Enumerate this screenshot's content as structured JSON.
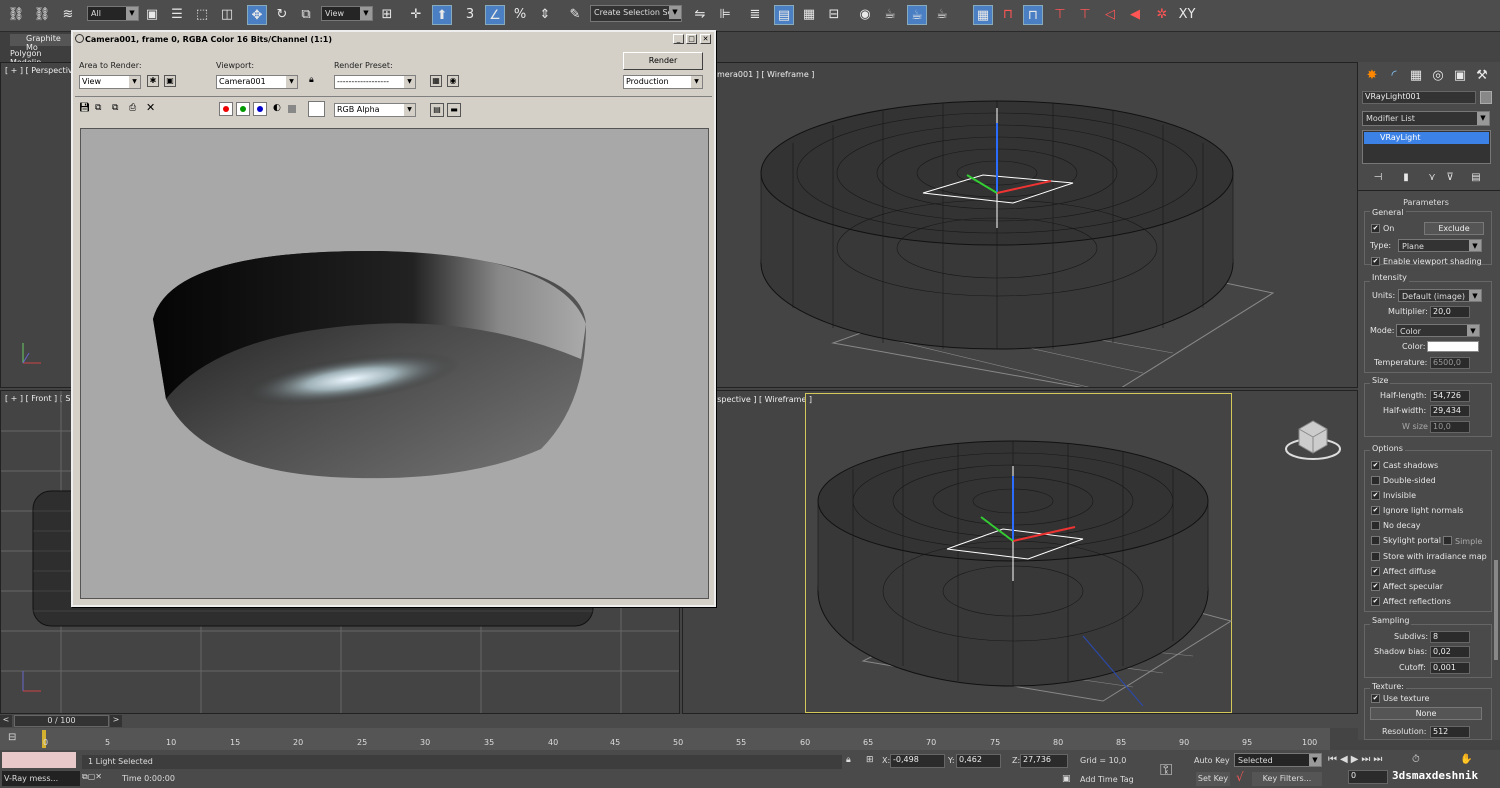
{
  "toolbar": {
    "filter": "All",
    "view": "View",
    "selection_set": "Create Selection Se"
  },
  "ribbon": {
    "tab1": "Graphite Mo",
    "tab2": "Polygon Modelin"
  },
  "viewports": {
    "top_left": "[ + ] [ Perspective",
    "top_right": "mera001 ] [ Wireframe ]",
    "bottom_left": "[ + ] [ Front ] [ Sha",
    "bottom_right": "erspective ] [ Wireframe ]"
  },
  "render_window": {
    "title": "Camera001, frame 0, RGBA Color 16 Bits/Channel (1:1)",
    "area_label": "Area to Render:",
    "area_value": "View",
    "viewport_label": "Viewport:",
    "viewport_value": "Camera001",
    "preset_label": "Render Preset:",
    "preset_value": "------------------",
    "render_button": "Render",
    "production": "Production",
    "channel": "RGB Alpha"
  },
  "command_panel": {
    "object_name": "VRayLight001",
    "modifier_list": "Modifier List",
    "stack_item": "VRayLight",
    "rollout_title": "Parameters",
    "general": "General",
    "on_label": "On",
    "exclude_btn": "Exclude",
    "type_label": "Type:",
    "type_value": "Plane",
    "enable_vp_shading": "Enable viewport shading",
    "intensity": "Intensity",
    "units_label": "Units:",
    "units_value": "Default (image)",
    "multiplier_label": "Multiplier:",
    "multiplier_value": "20,0",
    "mode_label": "Mode:",
    "mode_value": "Color",
    "color_label": "Color:",
    "temperature_label": "Temperature:",
    "temperature_value": "6500,0",
    "size": "Size",
    "half_length_label": "Half-length:",
    "half_length_value": "54,726",
    "half_width_label": "Half-width:",
    "half_width_value": "29,434",
    "w_size_label": "W size",
    "w_size_value": "10,0",
    "options": "Options",
    "opt_cast_shadows": "Cast shadows",
    "opt_double_sided": "Double-sided",
    "opt_invisible": "Invisible",
    "opt_ignore_normals": "Ignore light normals",
    "opt_no_decay": "No decay",
    "opt_skylight_portal": "Skylight portal",
    "opt_simple": "Simple",
    "opt_store_irradiance": "Store with irradiance map",
    "opt_affect_diffuse": "Affect diffuse",
    "opt_affect_specular": "Affect specular",
    "opt_affect_reflections": "Affect reflections",
    "sampling": "Sampling",
    "subdivs_label": "Subdivs:",
    "subdivs_value": "8",
    "shadow_bias_label": "Shadow bias:",
    "shadow_bias_value": "0,02",
    "cutoff_label": "Cutoff:",
    "cutoff_value": "0,001",
    "texture": "Texture:",
    "use_texture": "Use texture",
    "none_btn": "None",
    "resolution_label": "Resolution:",
    "resolution_value": "512"
  },
  "timeline": {
    "frame_counter": "0 / 100",
    "ticks": [
      "0",
      "5",
      "10",
      "15",
      "20",
      "25",
      "30",
      "35",
      "40",
      "45",
      "50",
      "55",
      "60",
      "65",
      "70",
      "75",
      "80",
      "85",
      "90",
      "95",
      "100"
    ]
  },
  "status": {
    "selection": "1 Light Selected",
    "vray_msg": "V-Ray mess...",
    "time": "Time  0:00:00",
    "x_label": "X:",
    "x_value": "-0,498",
    "y_label": "Y:",
    "y_value": "0,462",
    "z_label": "Z:",
    "z_value": "27,736",
    "grid": "Grid = 10,0",
    "add_time_tag": "Add Time Tag",
    "auto_key": "Auto Key",
    "set_key": "Set Key",
    "selected": "Selected",
    "key_filters": "Key Filters...",
    "frame": "0",
    "watermark": "3dsmaxdeshnik"
  }
}
